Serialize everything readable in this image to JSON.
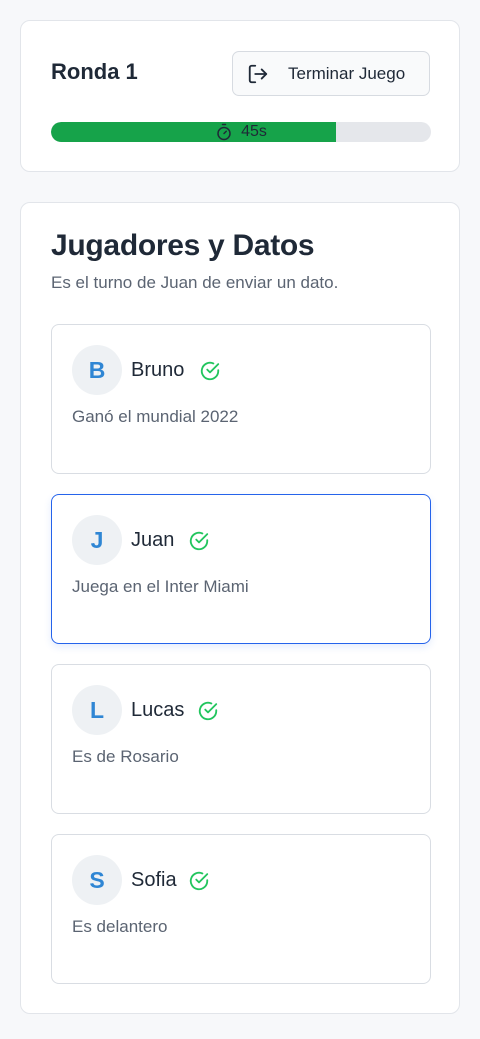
{
  "round": {
    "title": "Ronda 1",
    "end_button_label": "Terminar Juego",
    "timer_text": "45s",
    "time_progress_percent": 75,
    "progress_color": "#16a34a"
  },
  "players_section": {
    "title": "Jugadores y Datos",
    "subtitle": "Es el turno de Juan de enviar un dato.",
    "active_player": "Juan",
    "players": [
      {
        "initial": "B",
        "name": "Bruno",
        "fact": "Ganó el mundial 2022",
        "submitted": true
      },
      {
        "initial": "J",
        "name": "Juan",
        "fact": "Juega en el Inter Miami",
        "submitted": true
      },
      {
        "initial": "L",
        "name": "Lucas",
        "fact": "Es de Rosario",
        "submitted": true
      },
      {
        "initial": "S",
        "name": "Sofia",
        "fact": "Es delantero",
        "submitted": true
      }
    ]
  },
  "colors": {
    "accent_blue": "#2563eb",
    "check_green": "#22c55e",
    "avatar_text": "#2f86d4"
  },
  "icons": {
    "end_button": "logout-icon",
    "timer": "stopwatch-icon",
    "status": "check-circle-icon"
  }
}
